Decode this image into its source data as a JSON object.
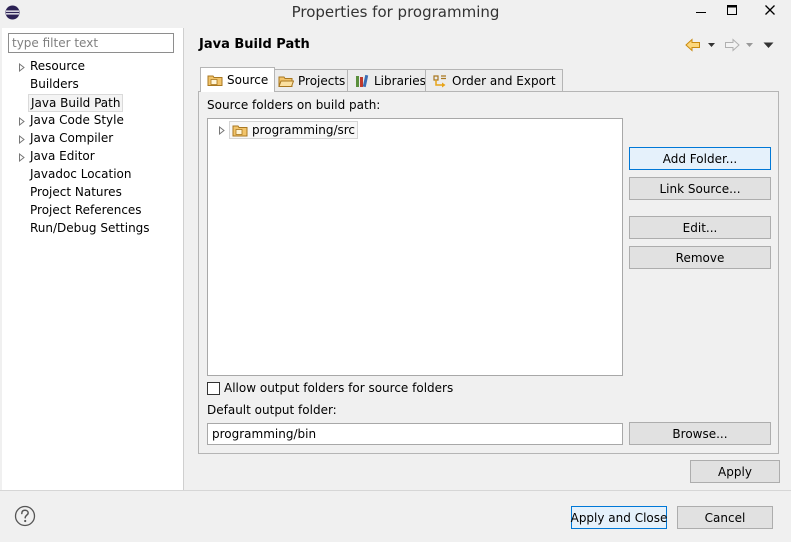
{
  "window": {
    "title": "Properties for programming"
  },
  "filter": {
    "placeholder": "type filter text"
  },
  "tree": {
    "items": [
      {
        "label": "Resource",
        "expandable": true
      },
      {
        "label": "Builders",
        "expandable": false
      },
      {
        "label": "Java Build Path",
        "expandable": false,
        "selected": true
      },
      {
        "label": "Java Code Style",
        "expandable": true
      },
      {
        "label": "Java Compiler",
        "expandable": true
      },
      {
        "label": "Java Editor",
        "expandable": true
      },
      {
        "label": "Javadoc Location",
        "expandable": false
      },
      {
        "label": "Project Natures",
        "expandable": false
      },
      {
        "label": "Project References",
        "expandable": false
      },
      {
        "label": "Run/Debug Settings",
        "expandable": false
      }
    ]
  },
  "page": {
    "title": "Java Build Path"
  },
  "tabs": [
    {
      "label": "Source",
      "active": true,
      "icon": "source-folder-icon"
    },
    {
      "label": "Projects",
      "active": false,
      "icon": "projects-folder-icon"
    },
    {
      "label": "Libraries",
      "active": false,
      "icon": "libraries-icon"
    },
    {
      "label": "Order and Export",
      "active": false,
      "icon": "order-export-icon"
    }
  ],
  "source": {
    "list_label": "Source folders on build path:",
    "folders": [
      "programming/src"
    ],
    "buttons": {
      "add_folder": "Add Folder...",
      "link_source": "Link Source...",
      "edit": "Edit...",
      "remove": "Remove",
      "browse": "Browse..."
    },
    "allow_output_label": "Allow output folders for source folders",
    "allow_output_checked": false,
    "output_label": "Default output folder:",
    "output_value": "programming/bin"
  },
  "footer": {
    "apply": "Apply",
    "apply_close": "Apply and Close",
    "cancel": "Cancel"
  },
  "colors": {
    "nav_arrow": "#e8a317",
    "folder": "#e6b85c",
    "focus_border": "#0078d7"
  }
}
